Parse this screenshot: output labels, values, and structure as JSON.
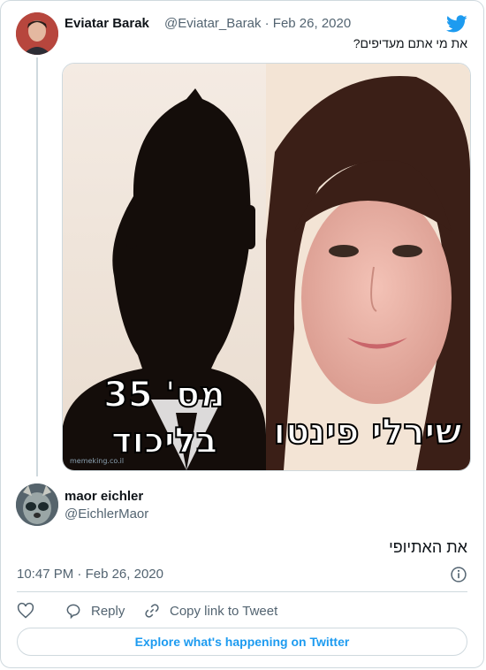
{
  "parent_tweet": {
    "display_name": "Eviatar Barak",
    "handle": "@Eviatar_Barak",
    "separator": "·",
    "date": "Feb 26, 2020",
    "text": "את מי אתם מעדיפים?",
    "media": {
      "left_caption_line1": "מס' 35",
      "left_caption_line2": "בליכוד",
      "right_caption": "שירלי פינטו",
      "watermark": "memeking.co.il"
    }
  },
  "reply_tweet": {
    "display_name": "maor eichler",
    "handle": "@EichlerMaor",
    "text": "את האתיופי",
    "time": "10:47 PM",
    "separator": "·",
    "date": "Feb 26, 2020"
  },
  "actions": {
    "reply_label": "Reply",
    "copy_link_label": "Copy link to Tweet"
  },
  "explore_label": "Explore what's happening on Twitter",
  "colors": {
    "accent": "#1d9bf0",
    "secondary_text": "#536471",
    "border": "#cfd9de"
  },
  "icons": [
    "twitter-bird-icon",
    "info-icon",
    "heart-icon",
    "reply-icon",
    "link-icon"
  ]
}
